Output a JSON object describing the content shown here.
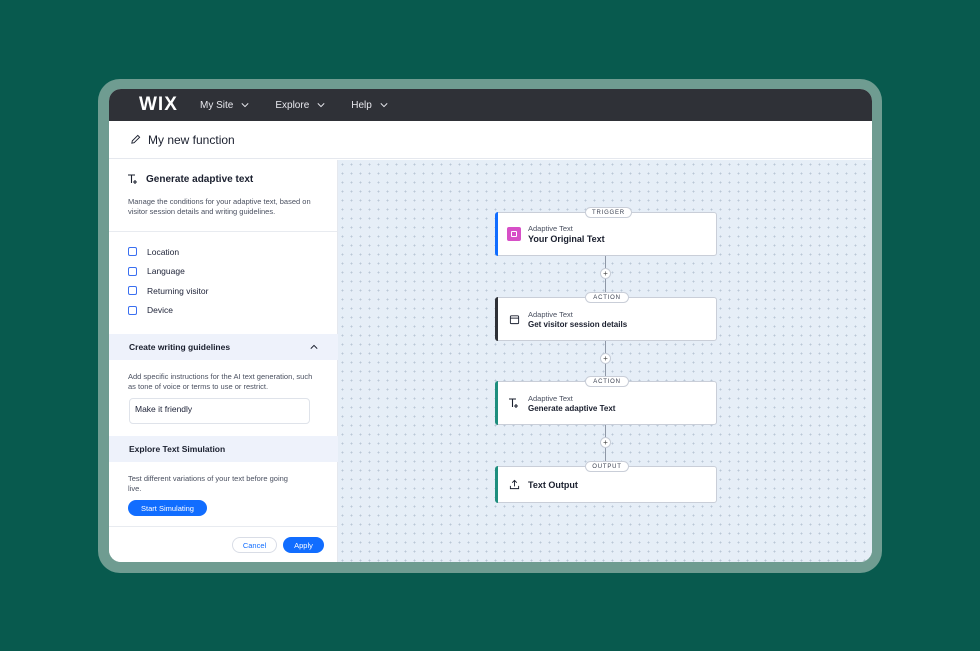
{
  "topbar": {
    "logo": "WIX",
    "nav": [
      {
        "label": "My Site"
      },
      {
        "label": "Explore"
      },
      {
        "label": "Help"
      }
    ]
  },
  "page": {
    "title": "My new function"
  },
  "sidebar": {
    "section_title": "Generate adaptive text",
    "section_desc": "Manage the conditions for your adaptive text, based on visitor session details and writing guidelines.",
    "conditions": [
      {
        "label": "Location",
        "checked": false
      },
      {
        "label": "Language",
        "checked": false
      },
      {
        "label": "Returning visitor",
        "checked": false
      },
      {
        "label": "Device",
        "checked": false
      }
    ],
    "guidelines": {
      "title": "Create writing guidelines",
      "desc": "Add specific instructions for the AI text generation, such as tone of voice or terms to use or restrict.",
      "input_value": "Make it friendly"
    },
    "simulation": {
      "title": "Explore Text Simulation",
      "desc": "Test different variations of your text before going live.",
      "button": "Start Simulating"
    },
    "footer": {
      "cancel": "Cancel",
      "apply": "Apply"
    }
  },
  "flow": {
    "plus_label": "+",
    "nodes": [
      {
        "tag": "TRIGGER",
        "sub": "Adaptive Text",
        "main": "Your Original Text",
        "accent": "#116dff",
        "icon": "adaptive-text-app-icon"
      },
      {
        "tag": "ACTION",
        "sub": "Adaptive Text",
        "main": "Get visitor session details",
        "accent": "#2f3137",
        "icon": "calendar-icon"
      },
      {
        "tag": "ACTION",
        "sub": "Adaptive Text",
        "main": "Generate adaptive Text",
        "accent": "#1e8e7e",
        "icon": "text-sparkle-icon"
      },
      {
        "tag": "OUTPUT",
        "sub": "",
        "main": "Text Output",
        "accent": "#1e8e7e",
        "icon": "upload-icon"
      }
    ]
  },
  "colors": {
    "background": "#085a4e",
    "frame": "#6f9c91",
    "topbar": "#2f3137",
    "primary": "#116dff",
    "trigger_icon": "#d74fc7"
  }
}
